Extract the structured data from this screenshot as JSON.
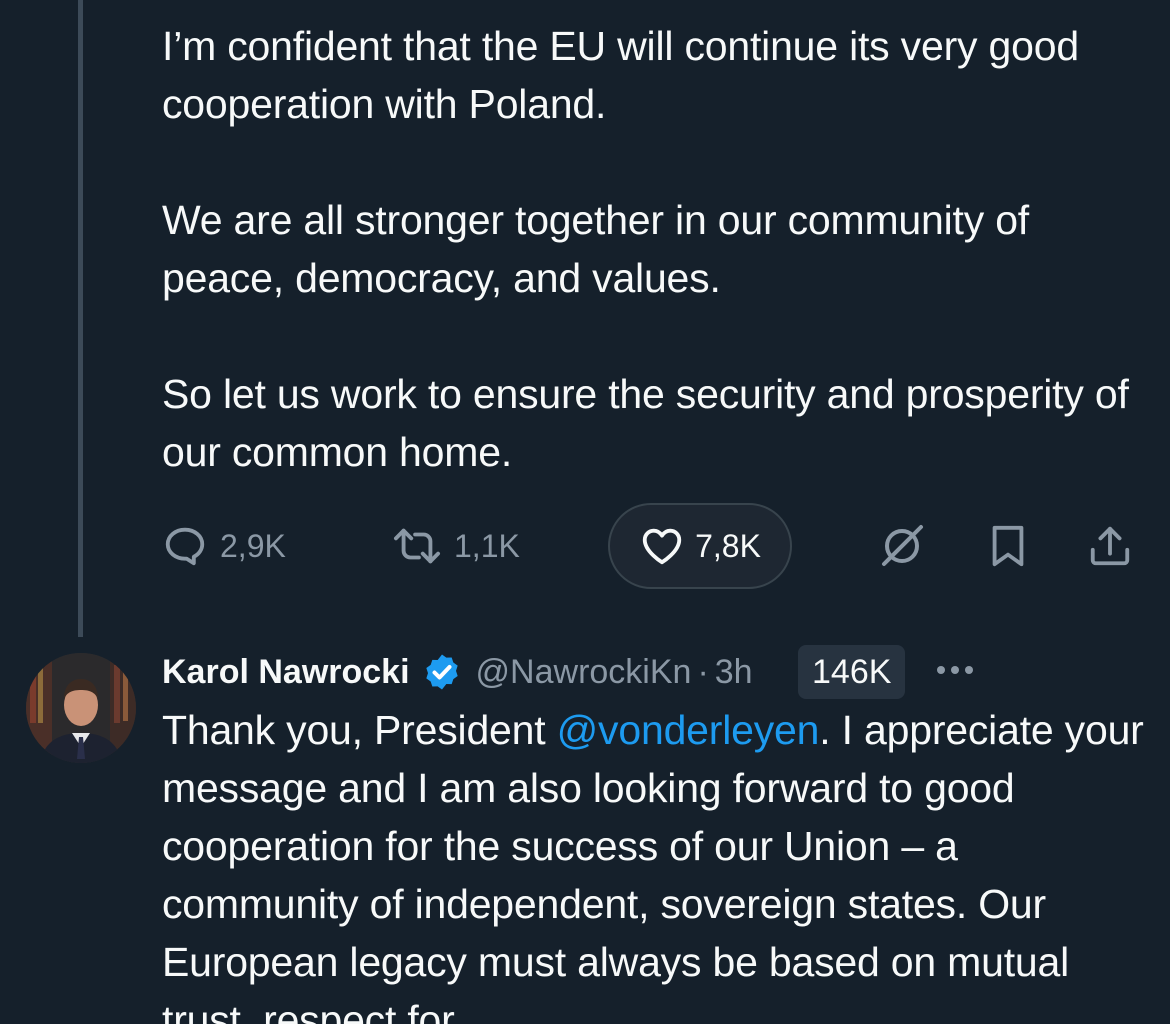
{
  "parent_tweet": {
    "paragraphs": [
      "I’m confident that the EU will continue its very good cooperation with Poland.",
      "We are all stronger together in our community of peace, democracy, and values.",
      "So let us work to ensure the security and prosperity of our common home."
    ],
    "actions": {
      "replies": "2,9K",
      "retweets": "1,1K",
      "likes": "7,8K"
    }
  },
  "reply_tweet": {
    "author_name": "Karol Nawrocki",
    "handle": "@NawrockiKn",
    "separator": "·",
    "time": "3h",
    "views": "146K",
    "text_before_mention": "Thank you, President ",
    "mention": "@vonderleyen",
    "text_after_mention": ". I appreciate your message and I am also looking forward to good cooperation for the success of our Union – a community of independent, sovereign states. Our European legacy must always be based on mutual trust, respect for"
  },
  "icons": {
    "reply": "speech-bubble-icon",
    "retweet": "retweet-arrows-icon",
    "like": "heart-icon",
    "grok": "grok-icon",
    "bookmark": "bookmark-icon",
    "share": "share-upload-icon",
    "verified": "verified-badge-icon",
    "more": "more-horizontal-icon"
  },
  "colors": {
    "background": "#15202b",
    "text": "#f7f9f9",
    "secondary": "#8b98a5",
    "accent": "#1d9bf0"
  }
}
